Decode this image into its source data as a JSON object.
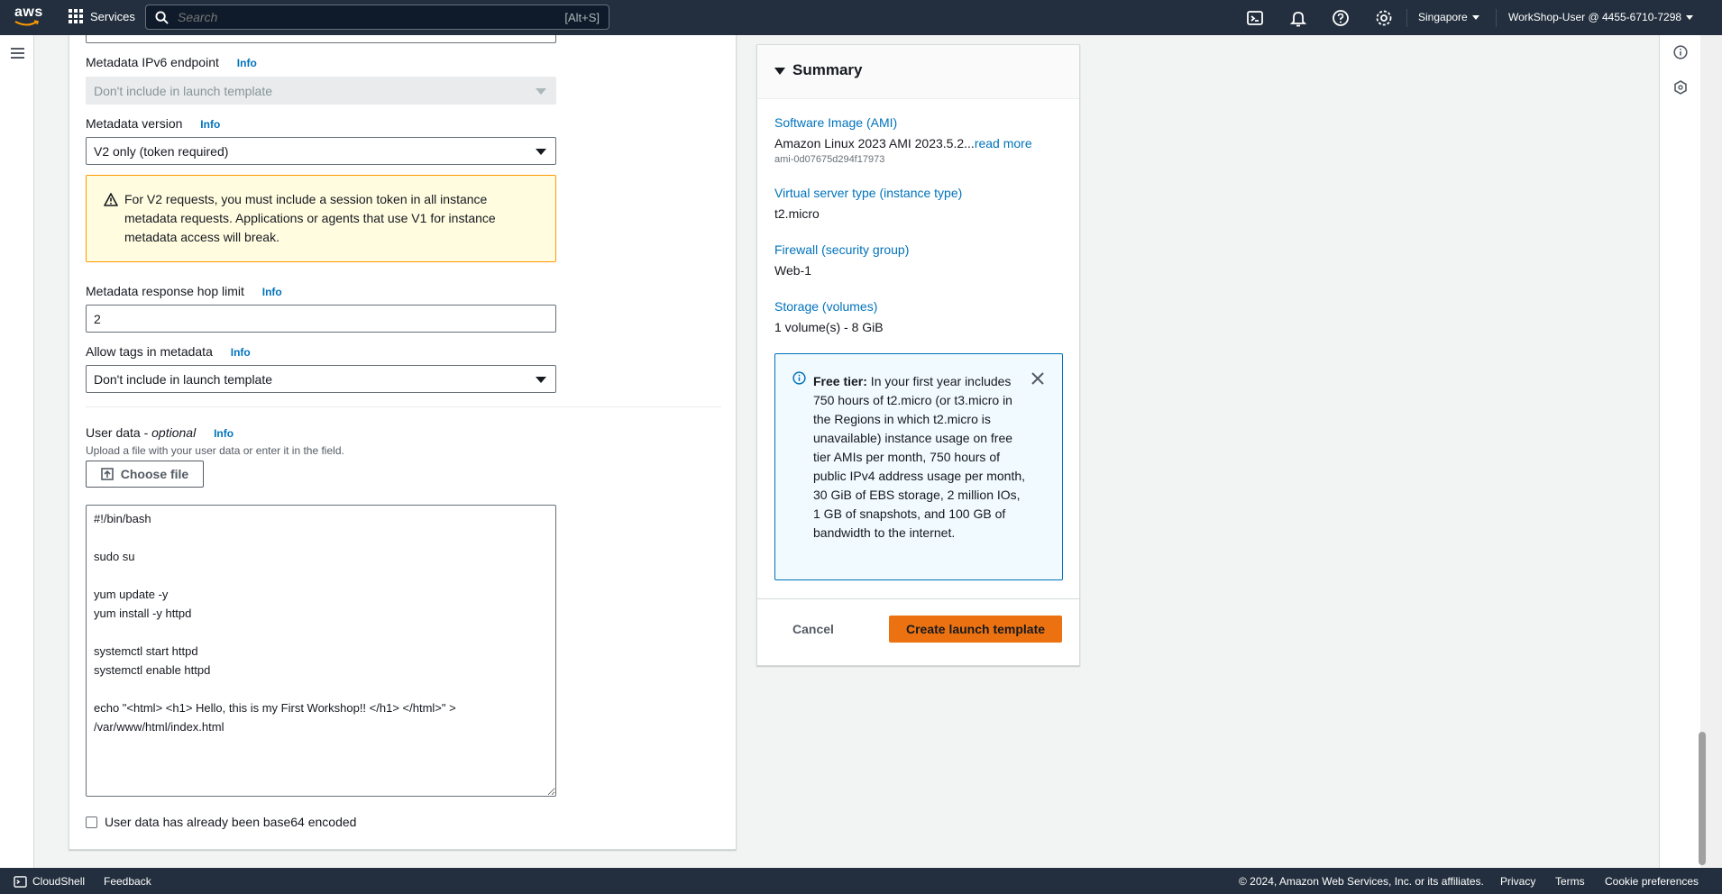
{
  "topnav": {
    "logo_text": "aws",
    "services_label": "Services",
    "search_placeholder": "Search",
    "search_shortcut": "[Alt+S]",
    "region": "Singapore",
    "user": "WorkShop-User @ 4455-6710-7298"
  },
  "form": {
    "ipv6": {
      "label": "Metadata IPv6 endpoint",
      "info": "Info",
      "value": "Don't include in launch template"
    },
    "version": {
      "label": "Metadata version",
      "info": "Info",
      "value": "V2 only (token required)"
    },
    "warning": "For V2 requests, you must include a session token in all instance metadata requests. Applications or agents that use V1 for instance metadata access will break.",
    "hop": {
      "label": "Metadata response hop limit",
      "info": "Info",
      "value": "2"
    },
    "tags": {
      "label": "Allow tags in metadata",
      "info": "Info",
      "value": "Don't include in launch template"
    },
    "userdata": {
      "label": "User data - ",
      "label_optional": "optional",
      "info": "Info",
      "description": "Upload a file with your user data or enter it in the field.",
      "choose_file": "Choose file",
      "content": "#!/bin/bash\n\nsudo su\n\nyum update -y\nyum install -y httpd\n\nsystemctl start httpd\nsystemctl enable httpd\n\necho \"<html> <h1> Hello, this is my First Workshop!! </h1> </html>\" >\n/var/www/html/index.html",
      "base64_label": "User data has already been base64 encoded"
    }
  },
  "summary": {
    "title": "Summary",
    "ami_label": "Software Image (AMI)",
    "ami_value": "Amazon Linux 2023 AMI 2023.5.2...",
    "ami_read_more": "read more",
    "ami_id": "ami-0d07675d294f17973",
    "instance_label": "Virtual server type (instance type)",
    "instance_value": "t2.micro",
    "firewall_label": "Firewall (security group)",
    "firewall_value": "Web-1",
    "storage_label": "Storage (volumes)",
    "storage_value": "1 volume(s) - 8 GiB",
    "freetier_title": "Free tier:",
    "freetier_text": " In your first year includes 750 hours of t2.micro (or t3.micro in the Regions in which t2.micro is unavailable) instance usage on free tier AMIs per month, 750 hours of public IPv4 address usage per month, 30 GiB of EBS storage, 2 million IOs, 1 GB of snapshots, and 100 GB of bandwidth to the internet.",
    "cancel": "Cancel",
    "create": "Create launch template"
  },
  "footer": {
    "cloudshell": "CloudShell",
    "feedback": "Feedback",
    "copyright": "© 2024, Amazon Web Services, Inc. or its affiliates.",
    "privacy": "Privacy",
    "terms": "Terms",
    "cookies": "Cookie preferences"
  },
  "colors": {
    "nav_bg": "#232f3e",
    "link": "#0073bb",
    "primary_button": "#ec7211",
    "warning_bg": "#fffce0",
    "info_bg": "#f1faff"
  }
}
